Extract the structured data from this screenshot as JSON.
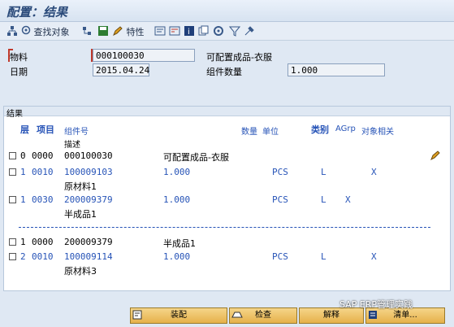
{
  "window": {
    "title": "配置：结果"
  },
  "toolbar": {
    "find_object_label": "查找对象",
    "characteristics_label": "特性"
  },
  "fields": {
    "material_label": "物料",
    "material_value": "000100030",
    "material_desc": "可配置成品-衣服",
    "date_label": "日期",
    "date_value": "2015.04.24",
    "quantity_label": "组件数量",
    "quantity_value": "1.000"
  },
  "results": {
    "section_title": "结果",
    "columns": {
      "level": "层",
      "item": "项目",
      "component": "组件号",
      "description": "描述",
      "quantity": "数量",
      "unit": "单位",
      "category": "类别",
      "agrp": "AGrp",
      "object_related": "对象相关"
    },
    "rows": [
      {
        "level": "0",
        "item": "0000",
        "component": "000100030",
        "desc_inline": "可配置成品-衣服",
        "qty": "",
        "unit": "",
        "cat": "",
        "agrp": "",
        "obj": "",
        "desc_below": ""
      },
      {
        "level": "1",
        "item": "0010",
        "component": "100009103",
        "desc_inline": "",
        "qty": "1.000",
        "unit": "PCS",
        "cat": "L",
        "agrp": "",
        "obj": "X",
        "desc_below": "原材料1"
      },
      {
        "level": "1",
        "item": "0030",
        "component": "200009379",
        "desc_inline": "",
        "qty": "1.000",
        "unit": "PCS",
        "cat": "L",
        "agrp": "X",
        "obj": "",
        "desc_below": "半成品1"
      },
      {
        "level": "1",
        "item": "0000",
        "component": "200009379",
        "desc_inline": "半成品1",
        "qty": "",
        "unit": "",
        "cat": "",
        "agrp": "",
        "obj": "",
        "desc_below": ""
      },
      {
        "level": "2",
        "item": "0010",
        "component": "100009114",
        "desc_inline": "",
        "qty": "1.000",
        "unit": "PCS",
        "cat": "L",
        "agrp": "",
        "obj": "X",
        "desc_below": "原材料3"
      }
    ]
  },
  "buttons": {
    "assemble": "装配",
    "check": "检查",
    "explain": "解释",
    "list": "清单..."
  },
  "watermark": "SAP ERP管理实践"
}
